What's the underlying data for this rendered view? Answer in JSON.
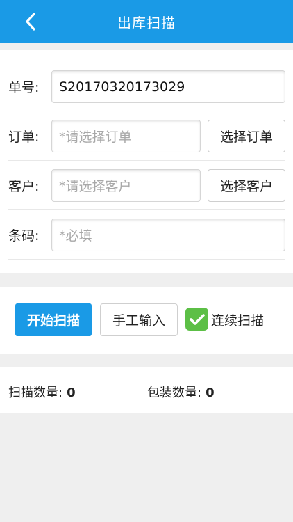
{
  "header": {
    "title": "出库扫描",
    "back_icon": "chevron-left-icon"
  },
  "form": {
    "order_no": {
      "label": "单号:",
      "value": "S20170320173029"
    },
    "order": {
      "label": "订单:",
      "placeholder": "*请选择订单",
      "button": "选择订单"
    },
    "customer": {
      "label": "客户:",
      "placeholder": "*请选择客户",
      "button": "选择客户"
    },
    "barcode": {
      "label": "条码:",
      "placeholder": "*必填"
    }
  },
  "actions": {
    "start_scan": "开始扫描",
    "manual_input": "手工输入",
    "continuous_scan": {
      "label": "连续扫描",
      "checked": true
    }
  },
  "stats": {
    "scan_count": {
      "label": "扫描数量:",
      "value": "0"
    },
    "package_count": {
      "label": "包装数量:",
      "value": "0"
    }
  },
  "colors": {
    "accent": "#1a9ae6",
    "checkbox_green": "#5cbf46"
  }
}
